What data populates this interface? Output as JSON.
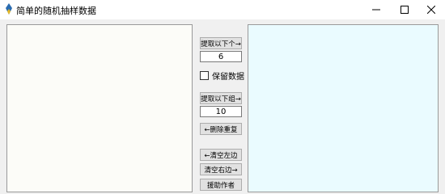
{
  "window": {
    "title": "简单的随机抽样数据",
    "minimize_glyph": "—",
    "maximize_glyph": "☐",
    "close_glyph": "✕"
  },
  "controls": {
    "extract_next_one": "提取以下个→",
    "count_single": "6",
    "keep_data_label": "保留数据",
    "keep_data_checked": false,
    "extract_next_group": "提取以下组→",
    "count_group": "10",
    "remove_duplicates": "←删除重复",
    "clear_left": "←清空左边",
    "clear_right": "清空右边→",
    "help_author": "援助作者"
  },
  "colors": {
    "left_pane_bg": "#fcfcf8",
    "right_pane_bg": "#eafbff",
    "app_icon_blue": "#2b6cb0",
    "app_icon_yellow": "#e8b923"
  }
}
